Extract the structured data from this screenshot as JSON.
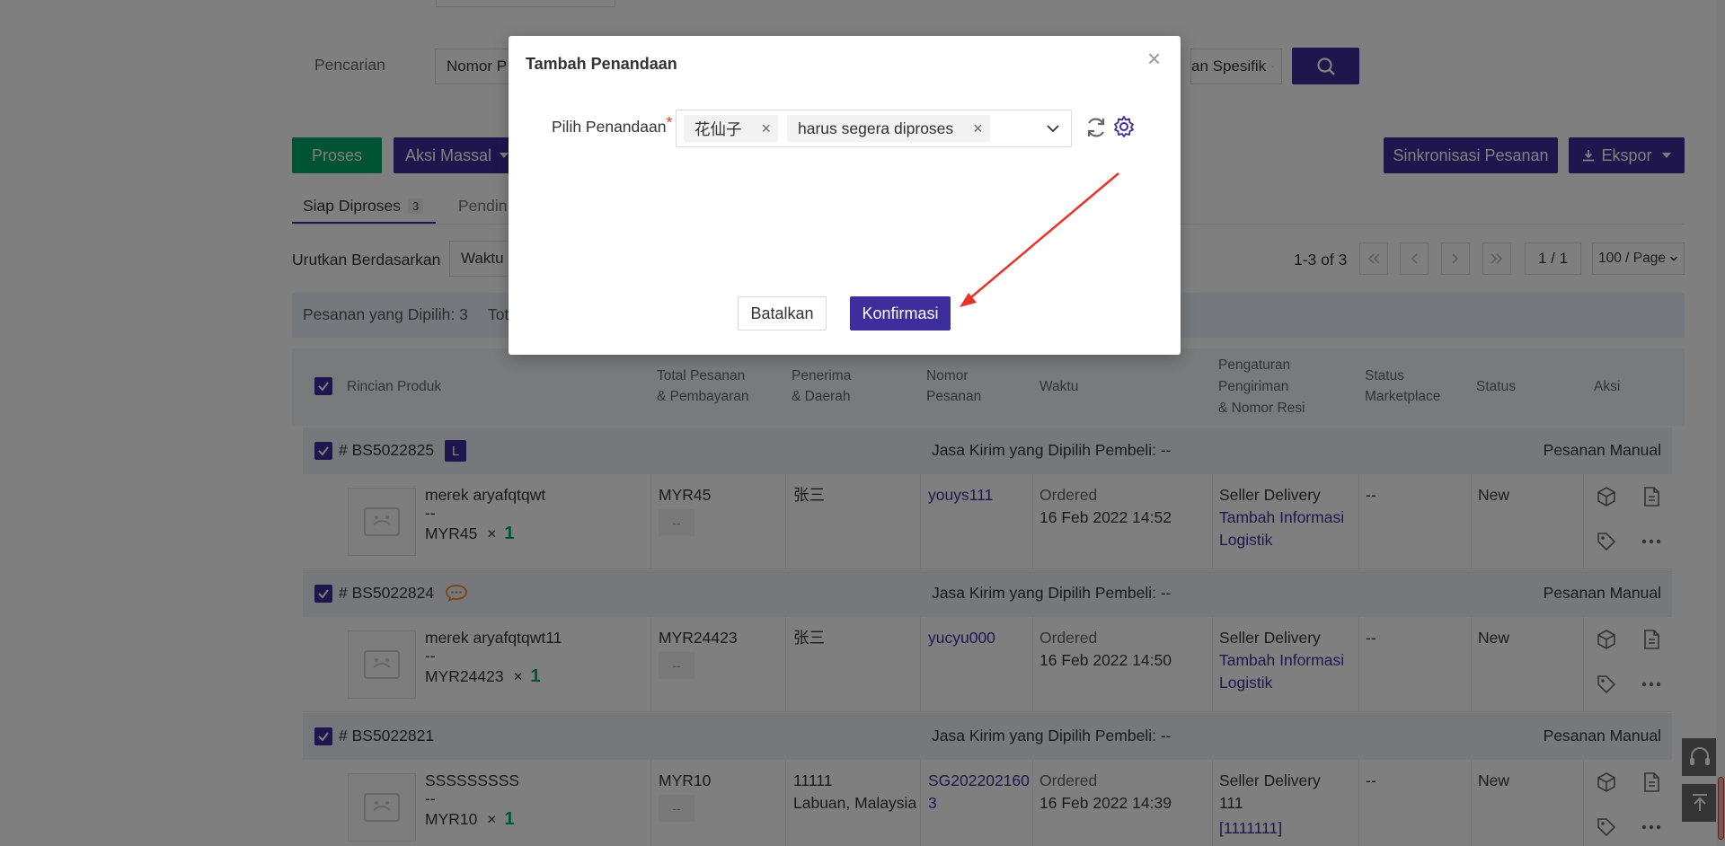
{
  "search": {
    "label": "Pencarian",
    "field_value": "Nomor P",
    "spec_value": "an Spesifik"
  },
  "toolbar": {
    "process_label": "Proses",
    "bulk_action_label": "Aksi Massal",
    "sync_label": "Sinkronisasi Pesanan",
    "export_label": "Ekspor"
  },
  "tabs": [
    {
      "label": "Siap Diproses",
      "count": "3"
    },
    {
      "label": "Pendin"
    }
  ],
  "sort": {
    "label": "Urutkan Berdasarkan",
    "value": "Waktu"
  },
  "pagination": {
    "range": "1-3 of 3",
    "page": "1 / 1",
    "page_size": "100 / Page"
  },
  "selection": {
    "selected_text": "Pesanan yang Dipilih: 3",
    "total_text": "Tot"
  },
  "table": {
    "headers": {
      "product": "Rincian Produk",
      "total_1": "Total Pesanan",
      "total_2": "& Pembayaran",
      "recipient_1": "Penerima",
      "recipient_2": "& Daerah",
      "order_1": "Nomor",
      "order_2": "Pesanan",
      "time": "Waktu",
      "shipping_1": "Pengaturan",
      "shipping_2": "Pengiriman",
      "shipping_3": "& Nomor Resi",
      "mkt_1": "Status",
      "mkt_2": "Marketplace",
      "status": "Status",
      "action": "Aksi"
    },
    "orders": [
      {
        "id": "# BS5022825",
        "badge": "L",
        "courier": "Jasa Kirim yang Dipilih Pembeli: --",
        "type": "Pesanan Manual",
        "product": "merek aryafqtqwt",
        "product_sub": "--",
        "price": "MYR45",
        "qty_x": "×",
        "qty": "1",
        "total": "MYR45",
        "payment": "--",
        "recipient": "张三",
        "recipient_region": "",
        "order_no": "youys111",
        "order_no_2": "",
        "time_status": "Ordered",
        "time": "16 Feb 2022 14:52",
        "ship_method": "Seller Delivery",
        "ship_link_1": "Tambah Informasi",
        "ship_link_2": "Logistik",
        "marketplace_status": "--",
        "status": "New"
      },
      {
        "id": "# BS5022824",
        "badge": "",
        "courier": "Jasa Kirim yang Dipilih Pembeli: --",
        "type": "Pesanan Manual",
        "product": "merek aryafqtqwt11",
        "product_sub": "--",
        "price": "MYR24423",
        "qty_x": "×",
        "qty": "1",
        "total": "MYR24423",
        "payment": "--",
        "recipient": "张三",
        "recipient_region": "",
        "order_no": "yucyu000",
        "order_no_2": "",
        "time_status": "Ordered",
        "time": "16 Feb 2022 14:50",
        "ship_method": "Seller Delivery",
        "ship_link_1": "Tambah Informasi",
        "ship_link_2": "Logistik",
        "marketplace_status": "--",
        "status": "New"
      },
      {
        "id": "# BS5022821",
        "badge": "",
        "courier": "Jasa Kirim yang Dipilih Pembeli: --",
        "type": "Pesanan Manual",
        "product": "SSSSSSSSS",
        "product_sub": "--",
        "price": "MYR10",
        "qty_x": "×",
        "qty": "1",
        "total": "MYR10",
        "payment": "--",
        "recipient": "11111",
        "recipient_region": "Labuan, Malaysia",
        "order_no": "SG202202160",
        "order_no_2": "3",
        "time_status": "Ordered",
        "time": "16 Feb 2022 14:39",
        "ship_method": "Seller Delivery",
        "ship_link_1": "111",
        "ship_link_2": "[1111111]",
        "marketplace_status": "--",
        "status": "New"
      }
    ]
  },
  "modal": {
    "title": "Tambah Penandaan",
    "field_label": "Pilih Penandaan",
    "required_mark": "*",
    "chips": [
      "花仙子",
      "harus segera diproses"
    ],
    "chip_remove": "×",
    "close": "×",
    "cancel_label": "Batalkan",
    "confirm_label": "Konfirmasi"
  },
  "colors": {
    "primary": "#3e2d9c",
    "success": "#00a86b",
    "annotation_arrow": "#e8332a"
  }
}
